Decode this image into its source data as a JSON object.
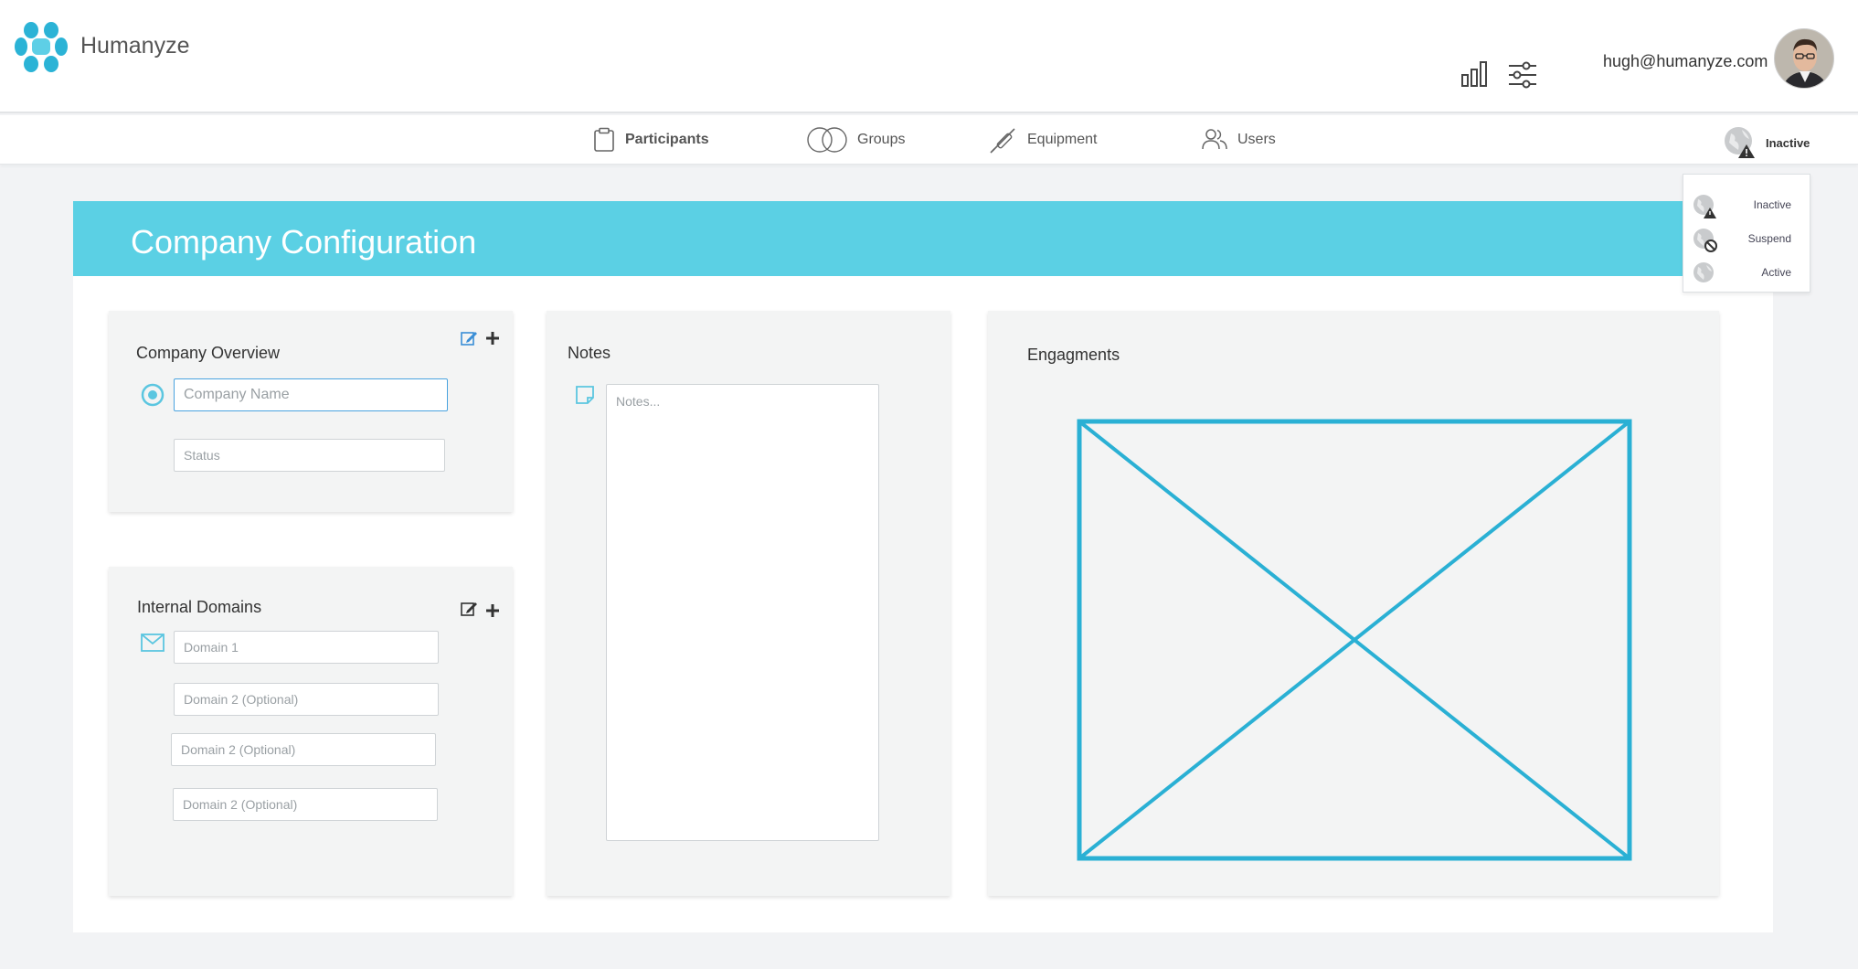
{
  "app": {
    "brand": "Humanyze"
  },
  "header": {
    "user_email": "hugh@humanyze.com"
  },
  "nav": {
    "items": [
      {
        "label": "Participants",
        "icon": "clipboard-icon"
      },
      {
        "label": "Groups",
        "icon": "groups-icon"
      },
      {
        "label": "Equipment",
        "icon": "equipment-icon"
      },
      {
        "label": "Users",
        "icon": "users-icon"
      }
    ],
    "status": {
      "label": "Inactive",
      "icon": "globe-warning-icon"
    }
  },
  "status_menu": {
    "options": [
      {
        "label": "Inactive",
        "icon": "globe-warning-icon"
      },
      {
        "label": "Suspend",
        "icon": "globe-suspend-icon"
      },
      {
        "label": "Active",
        "icon": "globe-icon"
      }
    ]
  },
  "page": {
    "title": "Company Configuration"
  },
  "overview": {
    "title": "Company Overview",
    "company_name_placeholder": "Company Name",
    "status_placeholder": "Status"
  },
  "domains": {
    "title": "Internal Domains",
    "fields": [
      {
        "placeholder": "Domain 1"
      },
      {
        "placeholder": "Domain 2 (Optional)"
      },
      {
        "placeholder": "Domain 2 (Optional)"
      },
      {
        "placeholder": "Domain 2 (Optional)"
      }
    ]
  },
  "notes": {
    "title": "Notes",
    "placeholder": "Notes..."
  },
  "engagements": {
    "title": "Engagments"
  },
  "colors": {
    "accent": "#5bd0e4",
    "placeholder_stroke": "#2ab0d4"
  }
}
